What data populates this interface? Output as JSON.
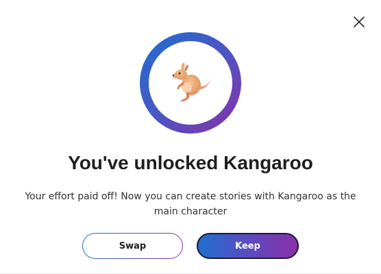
{
  "dialog": {
    "title": "You've unlocked Kangaroo",
    "message": "Your effort paid off! Now you can create stories with Kangaroo as the main character",
    "close_label": "Close",
    "avatar": {
      "icon": "kangaroo-icon"
    },
    "buttons": {
      "swap_label": "Swap",
      "keep_label": "Keep"
    }
  },
  "colors": {
    "gradient_start": "#1e70cf",
    "gradient_end": "#8a2fa8",
    "title_text": "#1f1f1f",
    "body_text": "#333333"
  }
}
